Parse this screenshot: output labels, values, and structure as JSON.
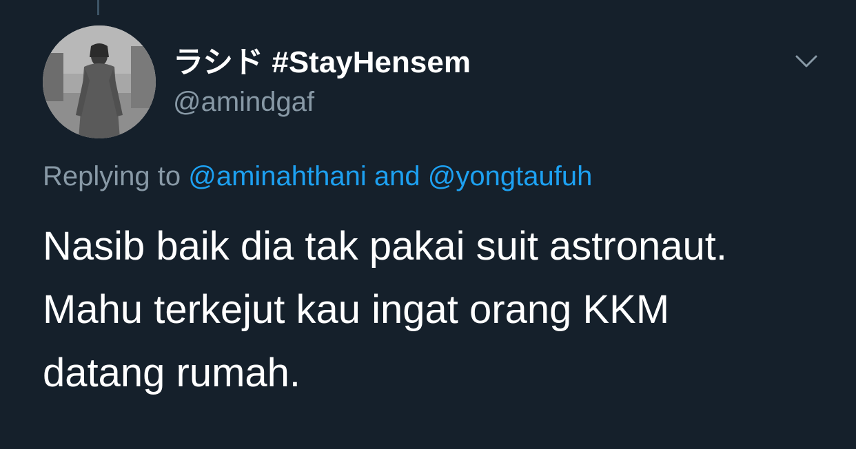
{
  "tweet": {
    "author": {
      "display_name": "ラシド #StayHensem",
      "handle": "@amindgaf",
      "avatar_icon": "profile-photo"
    },
    "reply": {
      "prefix": "Replying to",
      "mention_1": "@aminahthani",
      "conjunction": "and",
      "mention_2": "@yongtaufuh"
    },
    "text_lines": [
      "Nasib baik dia tak pakai suit astronaut.",
      "Mahu terkejut kau ingat orang KKM",
      "datang rumah."
    ],
    "menu_icon": "chevron-down-icon"
  },
  "colors": {
    "background": "#15202b",
    "text": "#ffffff",
    "secondary": "#8899a6",
    "link": "#1da1f2"
  }
}
